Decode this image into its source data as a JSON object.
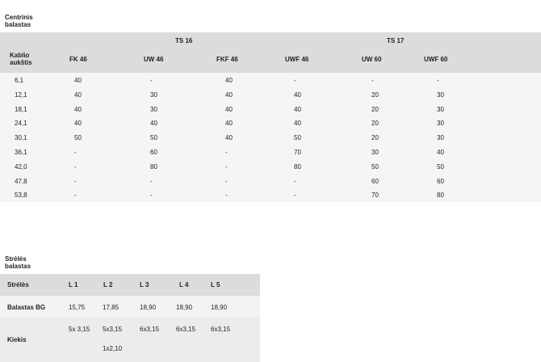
{
  "table1": {
    "title": "Centrinis\nbalastas",
    "row_header": "Kablio\naukštis",
    "groups": [
      "TS 16",
      "TS 17"
    ],
    "columns": [
      "FK 46",
      "UW 46",
      "FKF 46",
      "UWF 46",
      "UW 60",
      "UWF 60"
    ],
    "rows": [
      {
        "h": "6,1",
        "cells": [
          "40",
          "-",
          "40",
          "-",
          "-",
          "-"
        ]
      },
      {
        "h": "12,1",
        "cells": [
          "40",
          "30",
          "40",
          "40",
          "20",
          "30"
        ]
      },
      {
        "h": "18,1",
        "cells": [
          "40",
          "30",
          "40",
          "40",
          "20",
          "30"
        ]
      },
      {
        "h": "24,1",
        "cells": [
          "40",
          "40",
          "40",
          "40",
          "20",
          "30"
        ]
      },
      {
        "h": "30,1",
        "cells": [
          "50",
          "50",
          "40",
          "50",
          "20",
          "30"
        ]
      },
      {
        "h": "36,1",
        "cells": [
          "-",
          "60",
          "-",
          "70",
          "30",
          "40"
        ]
      },
      {
        "h": "42,0",
        "cells": [
          "-",
          "80",
          "-",
          "80",
          "50",
          "50"
        ]
      },
      {
        "h": "47,8",
        "cells": [
          "-",
          "-",
          "-",
          "-",
          "60",
          "60"
        ]
      },
      {
        "h": "53,8",
        "cells": [
          "-",
          "-",
          "-",
          "-",
          "70",
          "80"
        ]
      }
    ]
  },
  "table2": {
    "title": "Strėlės\nbalastas",
    "headers": [
      "Strėlės",
      "L 1",
      "L 2",
      "L 3",
      "L 4",
      "L 5"
    ],
    "balastas": {
      "label": "Balastas BG",
      "values": [
        "15,75",
        "17,85",
        "18,90",
        "18,90",
        "18,90"
      ]
    },
    "kiekis": {
      "label": "Kiekis",
      "values": [
        "5x 3,15",
        "5x3,15",
        "6x3,15",
        "6x3,15",
        "6x3,15"
      ],
      "extra": "1x2,10"
    }
  }
}
